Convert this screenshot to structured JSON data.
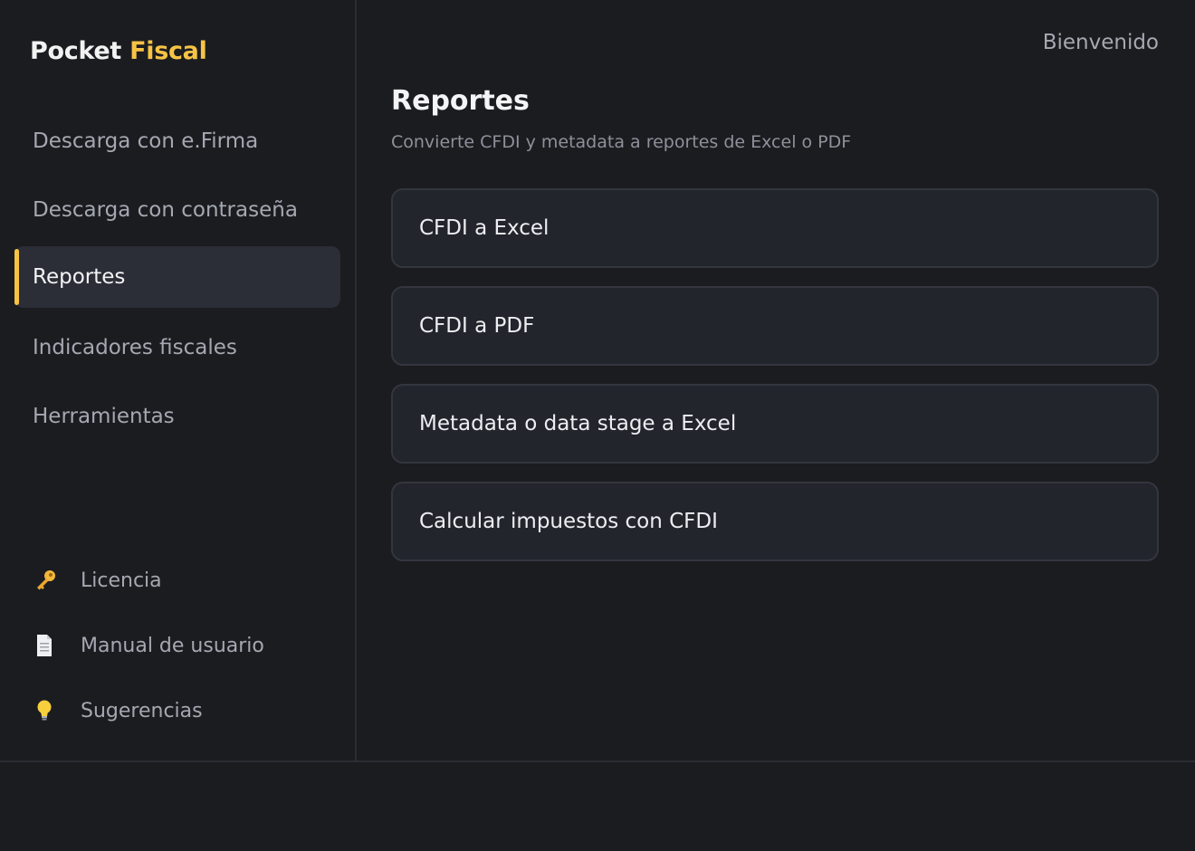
{
  "brand": {
    "primary": "Pocket",
    "accent": "Fiscal"
  },
  "sidebar": {
    "items": [
      {
        "label": "Descarga con e.Firma",
        "active": false
      },
      {
        "label": "Descarga con contraseña",
        "active": false
      },
      {
        "label": "Reportes",
        "active": true
      },
      {
        "label": "Indicadores fiscales",
        "active": false
      },
      {
        "label": "Herramientas",
        "active": false
      }
    ],
    "footer": [
      {
        "icon": "key-icon",
        "label": "Licencia"
      },
      {
        "icon": "document-icon",
        "label": "Manual de usuario"
      },
      {
        "icon": "lightbulb-icon",
        "label": "Sugerencias"
      }
    ]
  },
  "header": {
    "welcome": "Bienvenido"
  },
  "main": {
    "title": "Reportes",
    "subtitle": "Convierte CFDI y metadata a reportes de Excel o PDF",
    "cards": [
      {
        "label": "CFDI a Excel"
      },
      {
        "label": "CFDI a PDF"
      },
      {
        "label": "Metadata o data stage a Excel"
      },
      {
        "label": "Calcular impuestos con CFDI"
      }
    ]
  },
  "colors": {
    "accent": "#f6c344",
    "background": "#1b1c20",
    "card": "#23252d",
    "active_item": "#2b2e37"
  }
}
